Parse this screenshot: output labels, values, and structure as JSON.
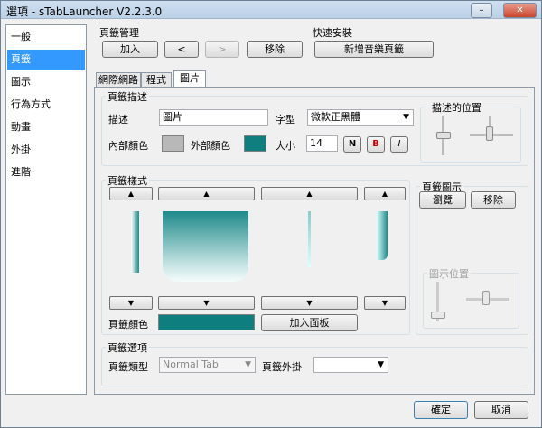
{
  "window": {
    "title": "選項 - sTabLauncher V2.2.3.0",
    "min": "–",
    "max": "□",
    "close": "✕"
  },
  "sidebar": {
    "items": [
      {
        "label": "一般"
      },
      {
        "label": "頁籤"
      },
      {
        "label": "圖示"
      },
      {
        "label": "行為方式"
      },
      {
        "label": "動畫"
      },
      {
        "label": "外掛"
      },
      {
        "label": "進階"
      }
    ],
    "selected": 1
  },
  "tab_mgmt": {
    "title": "頁籤管理",
    "add": "加入",
    "prev": "<",
    "next": ">",
    "remove": "移除"
  },
  "quick": {
    "title": "快速安裝",
    "new_music": "新增音樂頁籤"
  },
  "tabs": [
    {
      "label": "網際網路"
    },
    {
      "label": "程式"
    },
    {
      "label": "圖片"
    }
  ],
  "desc": {
    "title": "頁籤描述",
    "label": "描述",
    "value": "圖片",
    "font_label": "字型",
    "font_value": "微軟正黑體",
    "inner_color": "內部顏色",
    "outer_color": "外部顏色",
    "size_label": "大小",
    "size_value": "14",
    "bold": "N",
    "bold2": "B",
    "italic": "I",
    "pos_title": "描述的位置"
  },
  "style": {
    "title": "頁籤樣式",
    "color_label": "頁籤顏色",
    "add_panel": "加入面板",
    "up": "▲",
    "down": "▼"
  },
  "icon": {
    "title": "頁籤圖示",
    "browse": "瀏覽",
    "remove": "移除",
    "pos_title": "圖示位置"
  },
  "options": {
    "title": "頁籤選項",
    "type_label": "頁籤類型",
    "type_value": "Normal Tab",
    "plugin_label": "頁籤外掛",
    "plugin_value": ""
  },
  "footer": {
    "ok": "確定",
    "cancel": "取消"
  },
  "colors": {
    "accent": "#3399ff",
    "teal": "#0f7e7e",
    "inner": "#b8b8b8"
  }
}
